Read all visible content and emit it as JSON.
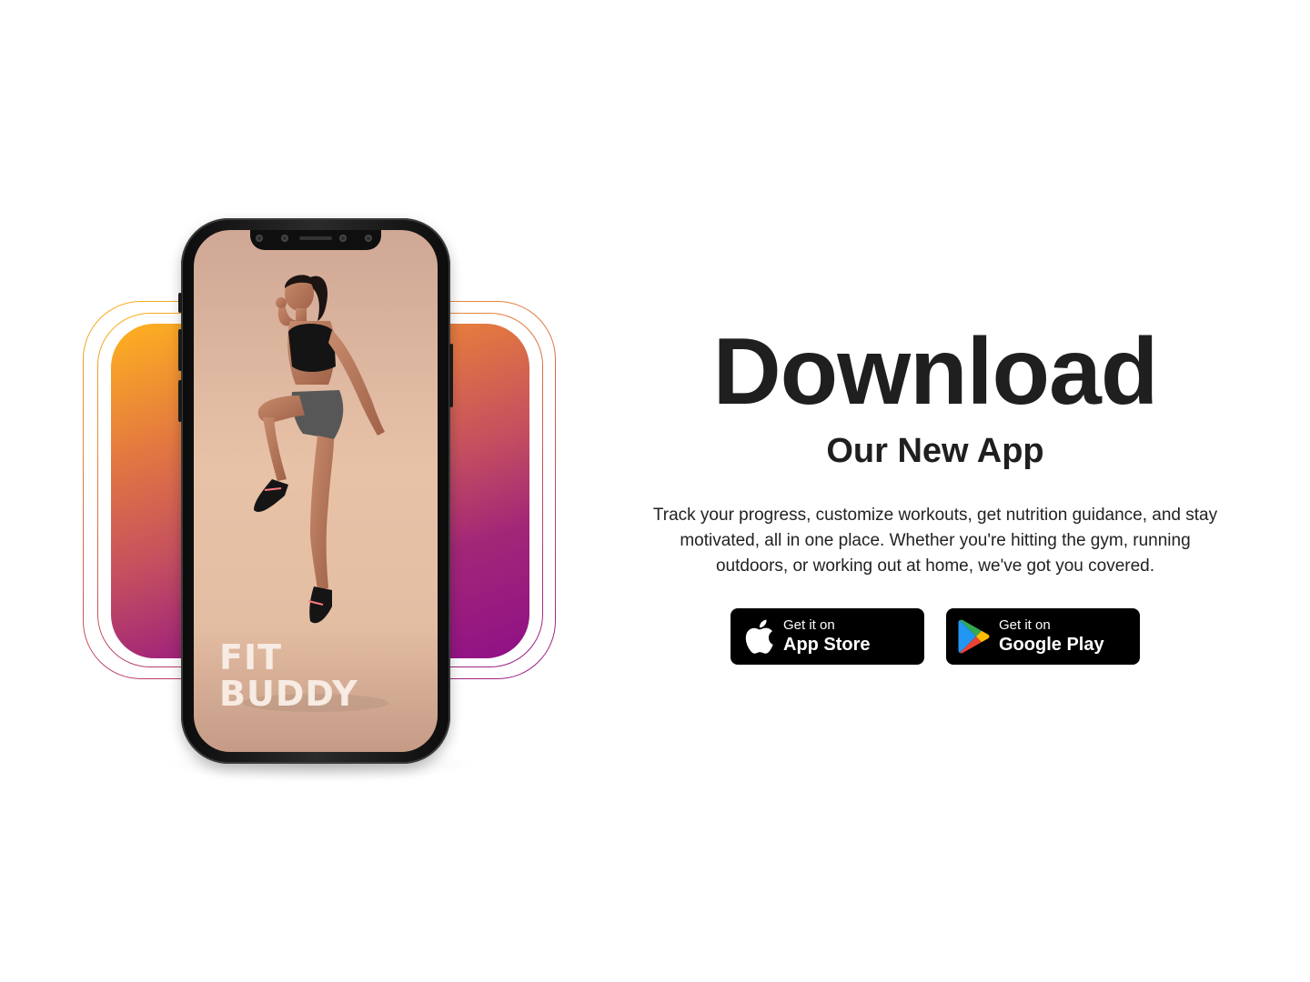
{
  "hero": {
    "headline": "Download",
    "subheadline": "Our New App",
    "description": "Track your progress, customize workouts, get nutrition guidance, and stay motivated, all in one place. Whether you're hitting the gym, running outdoors, or working out at home, we've got you covered."
  },
  "phone_screen": {
    "brand_line1": "FIT",
    "brand_line2": "BUDDY"
  },
  "store_buttons": {
    "app_store": {
      "small_label": "Get it on",
      "big_label": "App Store",
      "icon": "apple-icon"
    },
    "google_play": {
      "small_label": "Get it on",
      "big_label": "Google Play",
      "icon": "google-play-icon"
    }
  },
  "colors": {
    "gradient_top": "#ffb21f",
    "gradient_mid": "#c5505f",
    "gradient_bottom": "#8f1087",
    "button_bg": "#000000",
    "text_primary": "#1f1f1f",
    "background": "#ffffff"
  }
}
